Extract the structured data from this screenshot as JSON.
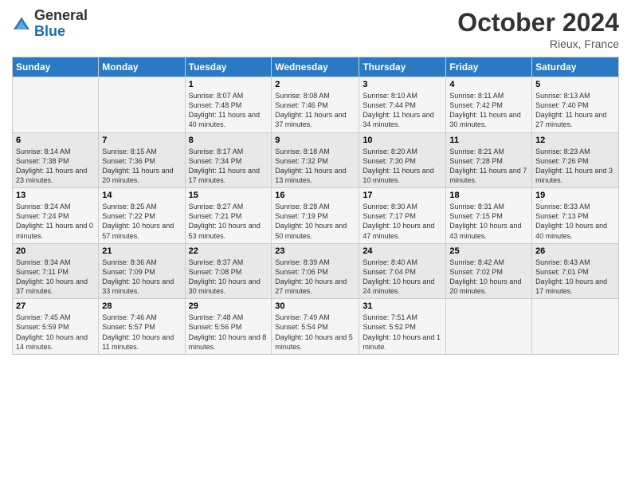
{
  "header": {
    "logo": {
      "line1": "General",
      "line2": "Blue"
    },
    "title": "October 2024",
    "location": "Rieux, France"
  },
  "weekdays": [
    "Sunday",
    "Monday",
    "Tuesday",
    "Wednesday",
    "Thursday",
    "Friday",
    "Saturday"
  ],
  "weeks": [
    [
      {
        "day": "",
        "info": ""
      },
      {
        "day": "",
        "info": ""
      },
      {
        "day": "1",
        "info": "Sunrise: 8:07 AM\nSunset: 7:48 PM\nDaylight: 11 hours and 40 minutes."
      },
      {
        "day": "2",
        "info": "Sunrise: 8:08 AM\nSunset: 7:46 PM\nDaylight: 11 hours and 37 minutes."
      },
      {
        "day": "3",
        "info": "Sunrise: 8:10 AM\nSunset: 7:44 PM\nDaylight: 11 hours and 34 minutes."
      },
      {
        "day": "4",
        "info": "Sunrise: 8:11 AM\nSunset: 7:42 PM\nDaylight: 11 hours and 30 minutes."
      },
      {
        "day": "5",
        "info": "Sunrise: 8:13 AM\nSunset: 7:40 PM\nDaylight: 11 hours and 27 minutes."
      }
    ],
    [
      {
        "day": "6",
        "info": "Sunrise: 8:14 AM\nSunset: 7:38 PM\nDaylight: 11 hours and 23 minutes."
      },
      {
        "day": "7",
        "info": "Sunrise: 8:15 AM\nSunset: 7:36 PM\nDaylight: 11 hours and 20 minutes."
      },
      {
        "day": "8",
        "info": "Sunrise: 8:17 AM\nSunset: 7:34 PM\nDaylight: 11 hours and 17 minutes."
      },
      {
        "day": "9",
        "info": "Sunrise: 8:18 AM\nSunset: 7:32 PM\nDaylight: 11 hours and 13 minutes."
      },
      {
        "day": "10",
        "info": "Sunrise: 8:20 AM\nSunset: 7:30 PM\nDaylight: 11 hours and 10 minutes."
      },
      {
        "day": "11",
        "info": "Sunrise: 8:21 AM\nSunset: 7:28 PM\nDaylight: 11 hours and 7 minutes."
      },
      {
        "day": "12",
        "info": "Sunrise: 8:23 AM\nSunset: 7:26 PM\nDaylight: 11 hours and 3 minutes."
      }
    ],
    [
      {
        "day": "13",
        "info": "Sunrise: 8:24 AM\nSunset: 7:24 PM\nDaylight: 11 hours and 0 minutes."
      },
      {
        "day": "14",
        "info": "Sunrise: 8:25 AM\nSunset: 7:22 PM\nDaylight: 10 hours and 57 minutes."
      },
      {
        "day": "15",
        "info": "Sunrise: 8:27 AM\nSunset: 7:21 PM\nDaylight: 10 hours and 53 minutes."
      },
      {
        "day": "16",
        "info": "Sunrise: 8:28 AM\nSunset: 7:19 PM\nDaylight: 10 hours and 50 minutes."
      },
      {
        "day": "17",
        "info": "Sunrise: 8:30 AM\nSunset: 7:17 PM\nDaylight: 10 hours and 47 minutes."
      },
      {
        "day": "18",
        "info": "Sunrise: 8:31 AM\nSunset: 7:15 PM\nDaylight: 10 hours and 43 minutes."
      },
      {
        "day": "19",
        "info": "Sunrise: 8:33 AM\nSunset: 7:13 PM\nDaylight: 10 hours and 40 minutes."
      }
    ],
    [
      {
        "day": "20",
        "info": "Sunrise: 8:34 AM\nSunset: 7:11 PM\nDaylight: 10 hours and 37 minutes."
      },
      {
        "day": "21",
        "info": "Sunrise: 8:36 AM\nSunset: 7:09 PM\nDaylight: 10 hours and 33 minutes."
      },
      {
        "day": "22",
        "info": "Sunrise: 8:37 AM\nSunset: 7:08 PM\nDaylight: 10 hours and 30 minutes."
      },
      {
        "day": "23",
        "info": "Sunrise: 8:39 AM\nSunset: 7:06 PM\nDaylight: 10 hours and 27 minutes."
      },
      {
        "day": "24",
        "info": "Sunrise: 8:40 AM\nSunset: 7:04 PM\nDaylight: 10 hours and 24 minutes."
      },
      {
        "day": "25",
        "info": "Sunrise: 8:42 AM\nSunset: 7:02 PM\nDaylight: 10 hours and 20 minutes."
      },
      {
        "day": "26",
        "info": "Sunrise: 8:43 AM\nSunset: 7:01 PM\nDaylight: 10 hours and 17 minutes."
      }
    ],
    [
      {
        "day": "27",
        "info": "Sunrise: 7:45 AM\nSunset: 5:59 PM\nDaylight: 10 hours and 14 minutes."
      },
      {
        "day": "28",
        "info": "Sunrise: 7:46 AM\nSunset: 5:57 PM\nDaylight: 10 hours and 11 minutes."
      },
      {
        "day": "29",
        "info": "Sunrise: 7:48 AM\nSunset: 5:56 PM\nDaylight: 10 hours and 8 minutes."
      },
      {
        "day": "30",
        "info": "Sunrise: 7:49 AM\nSunset: 5:54 PM\nDaylight: 10 hours and 5 minutes."
      },
      {
        "day": "31",
        "info": "Sunrise: 7:51 AM\nSunset: 5:52 PM\nDaylight: 10 hours and 1 minute."
      },
      {
        "day": "",
        "info": ""
      },
      {
        "day": "",
        "info": ""
      }
    ]
  ]
}
